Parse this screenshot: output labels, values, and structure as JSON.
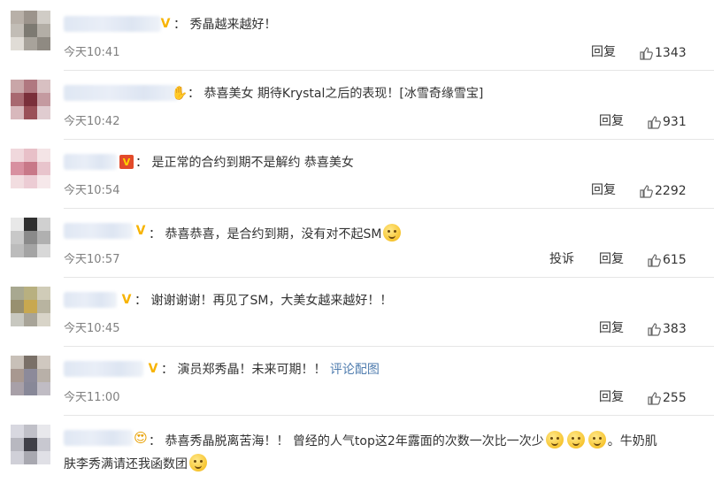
{
  "comments": [
    {
      "text": "： 秀晶越来越好！",
      "time": "今天10:41",
      "reply": "回复",
      "likes": "1343",
      "badge_icon": "vip-icon",
      "avatar_colors": [
        "#b8b0a8",
        "#9c948c",
        "#d0ccc6",
        "#c2bdb6",
        "#7d7a72",
        "#b3aea6",
        "#e0dcd6",
        "#a8a39b",
        "#8f8a82"
      ]
    },
    {
      "text": "： 恭喜美女 期待Krystal之后的表现！[冰雪奇缘雪宝]",
      "time": "今天10:42",
      "reply": "回复",
      "likes": "931",
      "badge_icon": "hand-emoji-icon",
      "avatar_colors": [
        "#c9a6a8",
        "#b07880",
        "#d8c0c2",
        "#a86870",
        "#7a2f3a",
        "#c49aa0",
        "#d8b8bc",
        "#9a5058",
        "#e0ccd0"
      ]
    },
    {
      "text": "： 是正常的合约到期不是解约 恭喜美女",
      "time": "今天10:54",
      "reply": "回复",
      "likes": "2292",
      "badge_icon": "flag-badge-icon",
      "avatar_colors": [
        "#f0d8dc",
        "#e8c0c8",
        "#f4e4e6",
        "#d890a0",
        "#c87888",
        "#e8c4cc",
        "#f2dde0",
        "#ecccd4",
        "#f6e8ea"
      ]
    },
    {
      "text": "： 恭喜恭喜，是合约到期，没有对不起SM",
      "time": "今天10:57",
      "report": "投诉",
      "reply": "回复",
      "likes": "615",
      "badge_icon": "vip-icon",
      "avatar_colors": [
        "#e8e8e8",
        "#303030",
        "#d0d0d0",
        "#c8c8c8",
        "#8a8a8a",
        "#b0b0b0",
        "#bcbcbc",
        "#a4a4a4",
        "#d8d8d8"
      ]
    },
    {
      "text": "： 谢谢谢谢！再见了SM，大美女越来越好！！",
      "time": "今天10:45",
      "reply": "回复",
      "likes": "383",
      "badge_icon": "vip-icon",
      "avatar_colors": [
        "#a8a890",
        "#b8b080",
        "#d0ccb8",
        "#989070",
        "#c8a850",
        "#b8b4a0",
        "#c8c8c0",
        "#a8a498",
        "#d8d4c8"
      ]
    },
    {
      "text": "： 演员郑秀晶！未来可期！！",
      "link": "评论配图",
      "time": "今天11:00",
      "reply": "回复",
      "likes": "255",
      "badge_icon": "vip-icon",
      "avatar_colors": [
        "#c8c0b8",
        "#7a7068",
        "#d0c8c0",
        "#a89890",
        "#8c8a9a",
        "#b8b0a8",
        "#a8a0a8",
        "#888898",
        "#c0bcc4"
      ]
    },
    {
      "text": "： 恭喜秀晶脱离苦海！！ 曾经的人气top这2年露面的次数一次比一次少",
      "text2": "。牛奶肌",
      "line2": "肤李秀满请还我函数团",
      "badge_icon": "heart-eyes-emoji-icon",
      "avatar_colors": [
        "#d8d8e0",
        "#c0c0c8",
        "#e8e8ec",
        "#b8b8c0",
        "#404048",
        "#c8c8d0",
        "#d0d0d8",
        "#a8a8b0",
        "#e0e0e6"
      ]
    }
  ]
}
